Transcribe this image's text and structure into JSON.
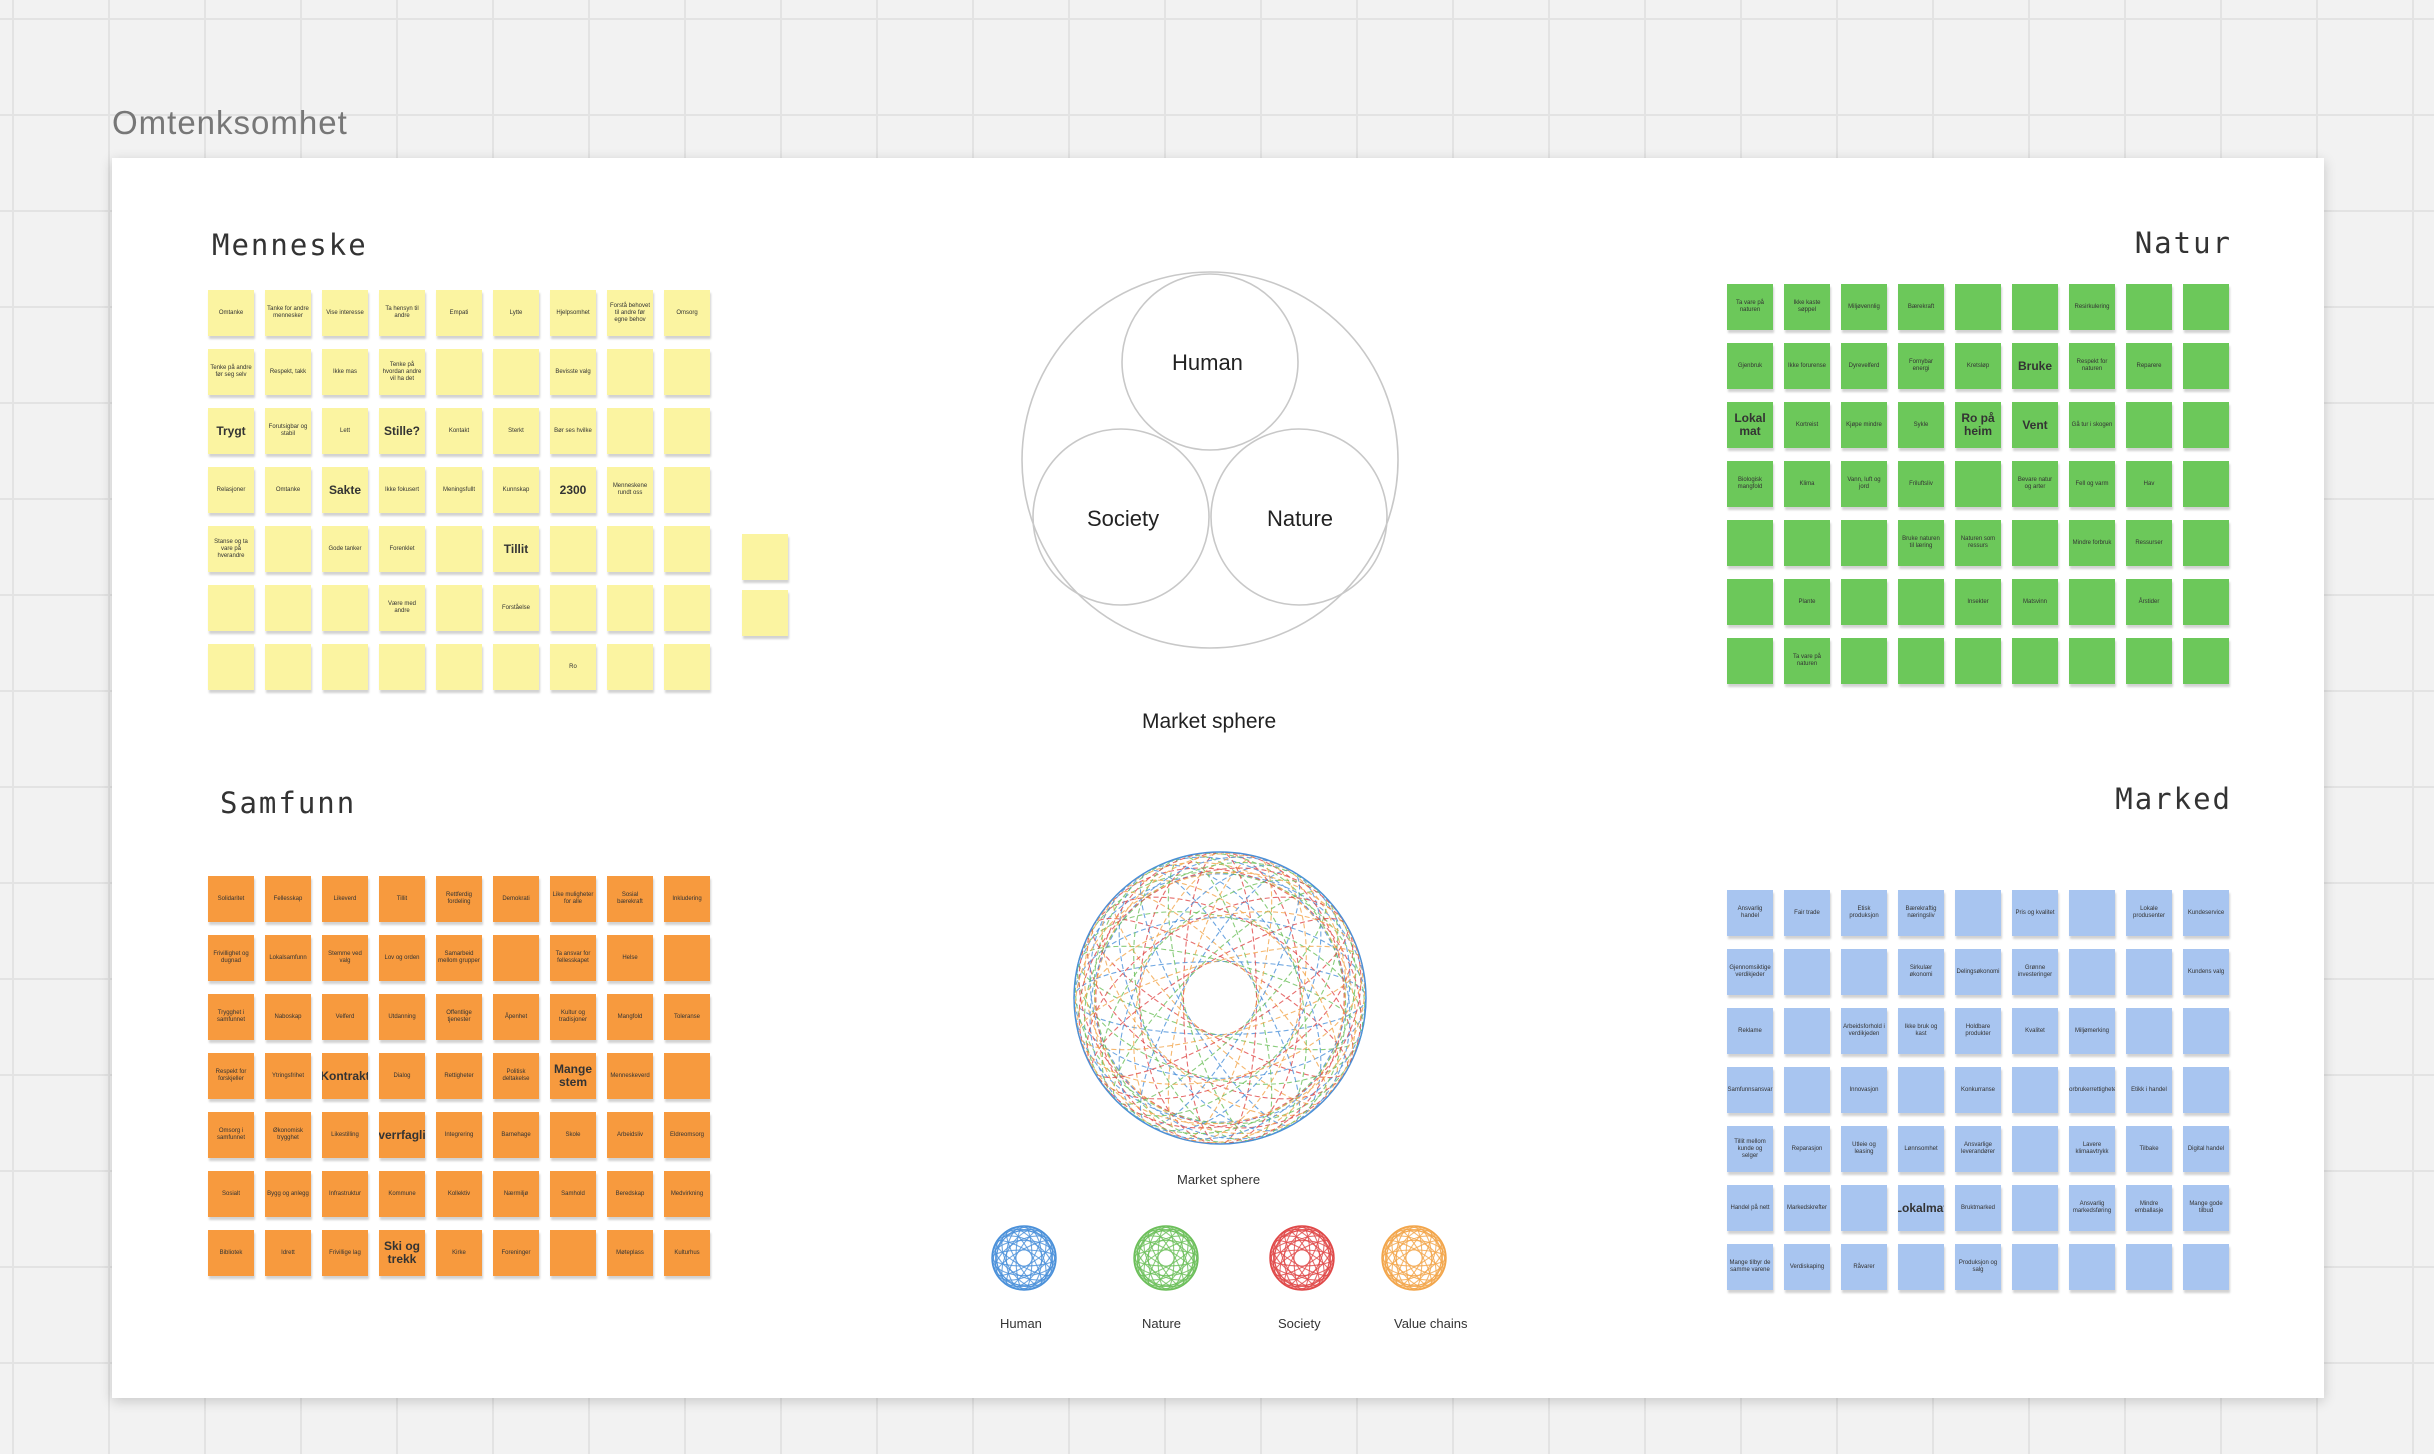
{
  "frame_title": "Omtenksomhet",
  "quadrants": {
    "menneske": {
      "title": "Menneske",
      "color": "#fbf4a1"
    },
    "natur": {
      "title": "Natur",
      "color": "#6cc85a"
    },
    "samfunn": {
      "title": "Samfunn",
      "color": "#f79a3e"
    },
    "marked": {
      "title": "Marked",
      "color": "#a8c5f0"
    }
  },
  "venn": {
    "circles": [
      "Human",
      "Society",
      "Nature"
    ],
    "caption": "Market sphere"
  },
  "sphere": {
    "caption": "Market sphere",
    "legend": [
      {
        "label": "Human",
        "color": "#4a90d9"
      },
      {
        "label": "Nature",
        "color": "#6cbf5a"
      },
      {
        "label": "Society",
        "color": "#e04848"
      },
      {
        "label": "Value chains",
        "color": "#f2a54a"
      }
    ]
  },
  "notes": {
    "menneske": [
      {
        "t": "Omtanke",
        "e": 0
      },
      {
        "t": "Tanke for andre mennesker",
        "e": 0
      },
      {
        "t": "Vise interesse",
        "e": 0
      },
      {
        "t": "Ta hensyn til andre",
        "e": 0
      },
      {
        "t": "Empati",
        "e": 0
      },
      {
        "t": "Lytte",
        "e": 0
      },
      {
        "t": "Hjelpsomhet",
        "e": 0
      },
      {
        "t": "Forstå behovet til andre før egne behov",
        "e": 0
      },
      {
        "t": "Omsorg",
        "e": 0
      },
      {
        "t": "Tenke på andre før seg selv",
        "e": 0
      },
      {
        "t": "Respekt, takk",
        "e": 0
      },
      {
        "t": "Ikke mas",
        "e": 0
      },
      {
        "t": "Tenke på hvordan andre vil ha det",
        "e": 0
      },
      {
        "t": "",
        "e": 0
      },
      {
        "t": "",
        "e": 0
      },
      {
        "t": "Bevisste valg",
        "e": 0
      },
      {
        "t": "",
        "e": 0
      },
      {
        "t": "",
        "e": 0
      },
      {
        "t": "Trygt",
        "e": 1
      },
      {
        "t": "Forutsigbar og stabil",
        "e": 0
      },
      {
        "t": "Lett",
        "e": 0
      },
      {
        "t": "Stille?",
        "e": 1
      },
      {
        "t": "Kontakt",
        "e": 0
      },
      {
        "t": "Sterkt",
        "e": 0
      },
      {
        "t": "Bør ses hvilke",
        "e": 0
      },
      {
        "t": "",
        "e": 0
      },
      {
        "t": "",
        "e": 0
      },
      {
        "t": "Relasjoner",
        "e": 0
      },
      {
        "t": "Omtanke",
        "e": 0
      },
      {
        "t": "Sakte",
        "e": 1
      },
      {
        "t": "Ikke fokusert",
        "e": 0
      },
      {
        "t": "Meningsfullt",
        "e": 0
      },
      {
        "t": "Kunnskap",
        "e": 0
      },
      {
        "t": "2300",
        "e": 1
      },
      {
        "t": "Menneskene rundt oss",
        "e": 0
      },
      {
        "t": "",
        "e": 0
      },
      {
        "t": "Stanse og ta vare på hverandre",
        "e": 0
      },
      {
        "t": "",
        "e": 0
      },
      {
        "t": "Gode tanker",
        "e": 0
      },
      {
        "t": "Forenklet",
        "e": 0
      },
      {
        "t": "",
        "e": 0
      },
      {
        "t": "Tillit",
        "e": 1
      },
      {
        "t": "",
        "e": 0
      },
      {
        "t": "",
        "e": 0
      },
      {
        "t": "",
        "e": 0
      },
      {
        "t": "",
        "e": 0
      },
      {
        "t": "",
        "e": 0
      },
      {
        "t": "",
        "e": 0
      },
      {
        "t": "Være med andre",
        "e": 0
      },
      {
        "t": "",
        "e": 0
      },
      {
        "t": "Forståelse",
        "e": 0
      },
      {
        "t": "",
        "e": 0
      },
      {
        "t": "",
        "e": 0
      },
      {
        "t": "",
        "e": 0
      },
      {
        "t": "",
        "e": 0
      },
      {
        "t": "",
        "e": 0
      },
      {
        "t": "",
        "e": 0
      },
      {
        "t": "",
        "e": 0
      },
      {
        "t": "",
        "e": 0
      },
      {
        "t": "",
        "e": 0
      },
      {
        "t": "Ro",
        "e": 0
      },
      {
        "t": "",
        "e": 0
      },
      {
        "t": "",
        "e": 0
      }
    ],
    "natur": [
      {
        "t": "Ta vare på naturen",
        "e": 0
      },
      {
        "t": "Ikke kaste søppel",
        "e": 0
      },
      {
        "t": "Miljøvennlig",
        "e": 0
      },
      {
        "t": "Bærekraft",
        "e": 0
      },
      {
        "t": "",
        "e": 0
      },
      {
        "t": "",
        "e": 0
      },
      {
        "t": "Resirkulering",
        "e": 0
      },
      {
        "t": "",
        "e": 0
      },
      {
        "t": "",
        "e": 0
      },
      {
        "t": "Gjenbruk",
        "e": 0
      },
      {
        "t": "Ikke forurense",
        "e": 0
      },
      {
        "t": "Dyrevelferd",
        "e": 0
      },
      {
        "t": "Fornybar energi",
        "e": 0
      },
      {
        "t": "Kretsløp",
        "e": 0
      },
      {
        "t": "Bruke",
        "e": 1
      },
      {
        "t": "Respekt for naturen",
        "e": 0
      },
      {
        "t": "Reparere",
        "e": 0
      },
      {
        "t": "",
        "e": 0
      },
      {
        "t": "Lokal mat",
        "e": 1
      },
      {
        "t": "Kortreist",
        "e": 0
      },
      {
        "t": "Kjøpe mindre",
        "e": 0
      },
      {
        "t": "Sykle",
        "e": 0
      },
      {
        "t": "Ro på heim",
        "e": 1
      },
      {
        "t": "Vent",
        "e": 1
      },
      {
        "t": "Gå tur i skogen",
        "e": 0
      },
      {
        "t": "",
        "e": 0
      },
      {
        "t": "",
        "e": 0
      },
      {
        "t": "Biologisk mangfold",
        "e": 0
      },
      {
        "t": "Klima",
        "e": 0
      },
      {
        "t": "Vann, luft og jord",
        "e": 0
      },
      {
        "t": "Friluftsliv",
        "e": 0
      },
      {
        "t": "",
        "e": 0
      },
      {
        "t": "Bevare natur og arter",
        "e": 0
      },
      {
        "t": "Fell og varm",
        "e": 0
      },
      {
        "t": "Hav",
        "e": 0
      },
      {
        "t": "",
        "e": 0
      },
      {
        "t": "",
        "e": 0
      },
      {
        "t": "",
        "e": 0
      },
      {
        "t": "",
        "e": 0
      },
      {
        "t": "Bruke naturen til læring",
        "e": 0
      },
      {
        "t": "Naturen som ressurs",
        "e": 0
      },
      {
        "t": "",
        "e": 0
      },
      {
        "t": "Mindre forbruk",
        "e": 0
      },
      {
        "t": "Ressurser",
        "e": 0
      },
      {
        "t": "",
        "e": 0
      },
      {
        "t": "",
        "e": 0
      },
      {
        "t": "Plante",
        "e": 0
      },
      {
        "t": "",
        "e": 0
      },
      {
        "t": "",
        "e": 0
      },
      {
        "t": "Insekter",
        "e": 0
      },
      {
        "t": "Matsvinn",
        "e": 0
      },
      {
        "t": "",
        "e": 0
      },
      {
        "t": "Årstider",
        "e": 0
      },
      {
        "t": "",
        "e": 0
      },
      {
        "t": "",
        "e": 0
      },
      {
        "t": "Ta vare på naturen",
        "e": 0
      },
      {
        "t": "",
        "e": 0
      },
      {
        "t": "",
        "e": 0
      },
      {
        "t": "",
        "e": 0
      },
      {
        "t": "",
        "e": 0
      },
      {
        "t": "",
        "e": 0
      },
      {
        "t": "",
        "e": 0
      },
      {
        "t": "",
        "e": 0
      }
    ],
    "samfunn": [
      {
        "t": "Solidaritet",
        "e": 0
      },
      {
        "t": "Fellesskap",
        "e": 0
      },
      {
        "t": "Likeverd",
        "e": 0
      },
      {
        "t": "Tillit",
        "e": 0
      },
      {
        "t": "Rettferdig fordeling",
        "e": 0
      },
      {
        "t": "Demokrati",
        "e": 0
      },
      {
        "t": "Like muligheter for alle",
        "e": 0
      },
      {
        "t": "Sosial bærekraft",
        "e": 0
      },
      {
        "t": "Inkludering",
        "e": 0
      },
      {
        "t": "Frivillighet og dugnad",
        "e": 0
      },
      {
        "t": "Lokalsamfunn",
        "e": 0
      },
      {
        "t": "Stemme ved valg",
        "e": 0
      },
      {
        "t": "Lov og orden",
        "e": 0
      },
      {
        "t": "Samarbeid mellom grupper",
        "e": 0
      },
      {
        "t": "",
        "e": 0
      },
      {
        "t": "Ta ansvar for fellesskapet",
        "e": 0
      },
      {
        "t": "Helse",
        "e": 0
      },
      {
        "t": "",
        "e": 0
      },
      {
        "t": "Trygghet i samfunnet",
        "e": 0
      },
      {
        "t": "Naboskap",
        "e": 0
      },
      {
        "t": "Velferd",
        "e": 0
      },
      {
        "t": "Utdanning",
        "e": 0
      },
      {
        "t": "Offentlige tjenester",
        "e": 0
      },
      {
        "t": "Åpenhet",
        "e": 0
      },
      {
        "t": "Kultur og tradisjoner",
        "e": 0
      },
      {
        "t": "Mangfold",
        "e": 0
      },
      {
        "t": "Toleranse",
        "e": 0
      },
      {
        "t": "Respekt for forskjeller",
        "e": 0
      },
      {
        "t": "Ytringsfrihet",
        "e": 0
      },
      {
        "t": "Kontrakt",
        "e": 1
      },
      {
        "t": "Dialog",
        "e": 0
      },
      {
        "t": "Rettigheter",
        "e": 0
      },
      {
        "t": "Politisk deltakelse",
        "e": 0
      },
      {
        "t": "Mange stem",
        "e": 1
      },
      {
        "t": "Menneskeverd",
        "e": 0
      },
      {
        "t": "",
        "e": 0
      },
      {
        "t": "Omsorg i samfunnet",
        "e": 0
      },
      {
        "t": "Økonomisk trygghet",
        "e": 0
      },
      {
        "t": "Likestilling",
        "e": 0
      },
      {
        "t": "Tverrfaglig",
        "e": 1
      },
      {
        "t": "Integrering",
        "e": 0
      },
      {
        "t": "Barnehage",
        "e": 0
      },
      {
        "t": "Skole",
        "e": 0
      },
      {
        "t": "Arbeidsliv",
        "e": 0
      },
      {
        "t": "Eldreomsorg",
        "e": 0
      },
      {
        "t": "Sosialt",
        "e": 0
      },
      {
        "t": "Bygg og anlegg",
        "e": 0
      },
      {
        "t": "Infrastruktur",
        "e": 0
      },
      {
        "t": "Kommune",
        "e": 0
      },
      {
        "t": "Kollektiv",
        "e": 0
      },
      {
        "t": "Nærmiljø",
        "e": 0
      },
      {
        "t": "Samhold",
        "e": 0
      },
      {
        "t": "Beredskap",
        "e": 0
      },
      {
        "t": "Medvirkning",
        "e": 0
      },
      {
        "t": "Bibliotek",
        "e": 0
      },
      {
        "t": "Idrett",
        "e": 0
      },
      {
        "t": "Frivillige lag",
        "e": 0
      },
      {
        "t": "Ski og trekk",
        "e": 1
      },
      {
        "t": "Kirke",
        "e": 0
      },
      {
        "t": "Foreninger",
        "e": 0
      },
      {
        "t": "",
        "e": 0
      },
      {
        "t": "Møteplass",
        "e": 0
      },
      {
        "t": "Kulturhus",
        "e": 0
      }
    ],
    "marked": [
      {
        "t": "Ansvarlig handel",
        "e": 0
      },
      {
        "t": "Fair trade",
        "e": 0
      },
      {
        "t": "Etisk produksjon",
        "e": 0
      },
      {
        "t": "Bærekraftig næringsliv",
        "e": 0
      },
      {
        "t": "",
        "e": 0
      },
      {
        "t": "Pris og kvalitet",
        "e": 0
      },
      {
        "t": "",
        "e": 0
      },
      {
        "t": "Lokale produsenter",
        "e": 0
      },
      {
        "t": "Kundeservice",
        "e": 0
      },
      {
        "t": "Gjennomsiktige verdikjeder",
        "e": 0
      },
      {
        "t": "",
        "e": 0
      },
      {
        "t": "",
        "e": 0
      },
      {
        "t": "Sirkulær økonomi",
        "e": 0
      },
      {
        "t": "Delingsøkonomi",
        "e": 0
      },
      {
        "t": "Grønne investeringer",
        "e": 0
      },
      {
        "t": "",
        "e": 0
      },
      {
        "t": "",
        "e": 0
      },
      {
        "t": "Kundens valg",
        "e": 0
      },
      {
        "t": "Reklame",
        "e": 0
      },
      {
        "t": "",
        "e": 0
      },
      {
        "t": "Arbeidsforhold i verdikjeden",
        "e": 0
      },
      {
        "t": "Ikke bruk og kast",
        "e": 0
      },
      {
        "t": "Holdbare produkter",
        "e": 0
      },
      {
        "t": "Kvalitet",
        "e": 0
      },
      {
        "t": "Miljømerking",
        "e": 0
      },
      {
        "t": "",
        "e": 0
      },
      {
        "t": "",
        "e": 0
      },
      {
        "t": "Samfunnsansvar",
        "e": 0
      },
      {
        "t": "",
        "e": 0
      },
      {
        "t": "Innovasjon",
        "e": 0
      },
      {
        "t": "",
        "e": 0
      },
      {
        "t": "Konkurranse",
        "e": 0
      },
      {
        "t": "",
        "e": 0
      },
      {
        "t": "Forbrukerrettigheter",
        "e": 0
      },
      {
        "t": "Etikk i handel",
        "e": 0
      },
      {
        "t": "",
        "e": 0
      },
      {
        "t": "Tillit mellom kunde og selger",
        "e": 0
      },
      {
        "t": "Reparasjon",
        "e": 0
      },
      {
        "t": "Utleie og leasing",
        "e": 0
      },
      {
        "t": "Lønnsomhet",
        "e": 0
      },
      {
        "t": "Ansvarlige leverandører",
        "e": 0
      },
      {
        "t": "",
        "e": 0
      },
      {
        "t": "Lavere klimaavtrykk",
        "e": 0
      },
      {
        "t": "Tilbake",
        "e": 0
      },
      {
        "t": "Digital handel",
        "e": 0
      },
      {
        "t": "Handel på nett",
        "e": 0
      },
      {
        "t": "Markedskrefter",
        "e": 0
      },
      {
        "t": "",
        "e": 0
      },
      {
        "t": "Lokalmat",
        "e": 1
      },
      {
        "t": "Bruktmarked",
        "e": 0
      },
      {
        "t": "",
        "e": 0
      },
      {
        "t": "Ansvarlig markedsføring",
        "e": 0
      },
      {
        "t": "Mindre emballasje",
        "e": 0
      },
      {
        "t": "Mange gode tilbud",
        "e": 0
      },
      {
        "t": "Mange tilbyr de samme varene",
        "e": 0
      },
      {
        "t": "Verdiskaping",
        "e": 0
      },
      {
        "t": "Råvarer",
        "e": 0
      },
      {
        "t": "",
        "e": 0
      },
      {
        "t": "Produksjon og salg",
        "e": 0
      },
      {
        "t": "",
        "e": 0
      },
      {
        "t": "",
        "e": 0
      },
      {
        "t": "",
        "e": 0
      },
      {
        "t": "",
        "e": 0
      }
    ]
  }
}
